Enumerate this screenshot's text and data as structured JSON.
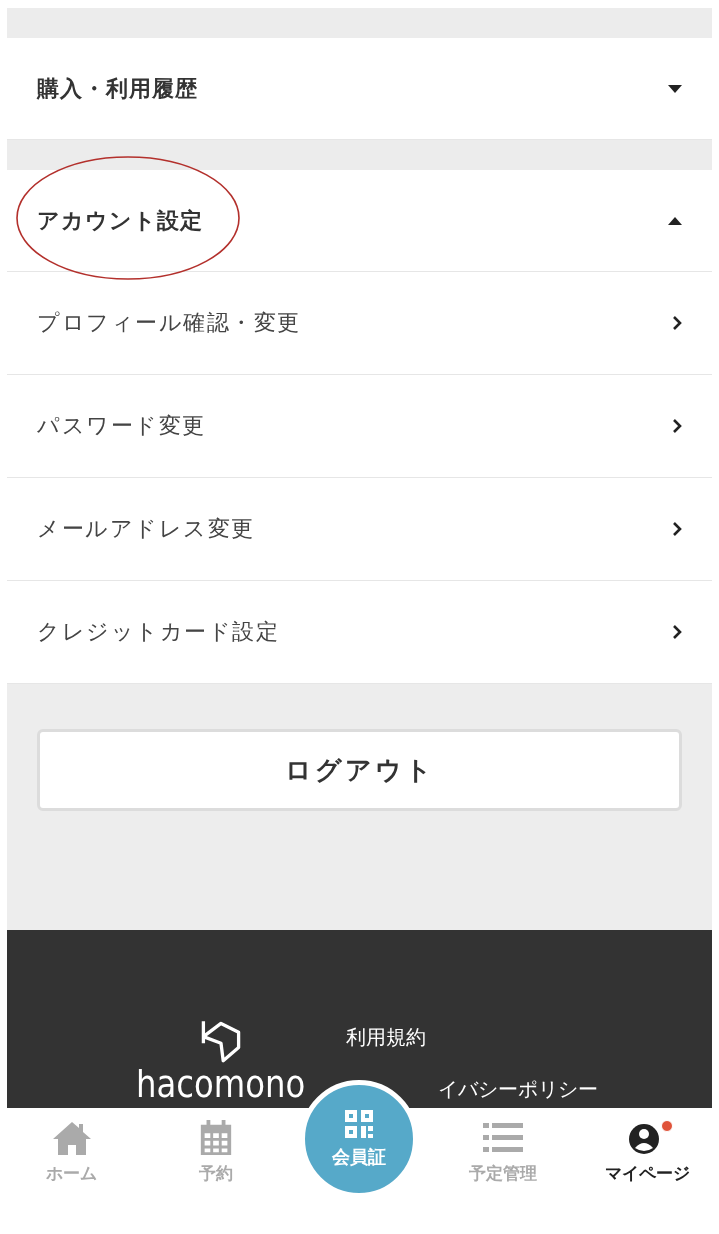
{
  "sections": [
    {
      "title": "購入・利用履歴",
      "expanded": false,
      "highlighted": false
    },
    {
      "title": "アカウント設定",
      "expanded": true,
      "highlighted": true,
      "items": [
        {
          "label": "プロフィール確認・変更"
        },
        {
          "label": "パスワード変更"
        },
        {
          "label": "メールアドレス変更"
        },
        {
          "label": "クレジットカード設定"
        }
      ]
    }
  ],
  "logout_button": "ログアウト",
  "footer": {
    "logo": "hacomono",
    "links": [
      "利用規約",
      "イバシーポリシー"
    ]
  },
  "nav": [
    {
      "kind": "home",
      "label": "ホーム",
      "selected": false,
      "notification": false
    },
    {
      "kind": "calendar",
      "label": "予約",
      "selected": false,
      "notification": false
    },
    {
      "kind": "qr",
      "label": "会員証",
      "selected": false,
      "notification": false
    },
    {
      "kind": "list",
      "label": "予定管理",
      "selected": false,
      "notification": false
    },
    {
      "kind": "user",
      "label": "マイページ",
      "selected": true,
      "notification": true
    }
  ]
}
